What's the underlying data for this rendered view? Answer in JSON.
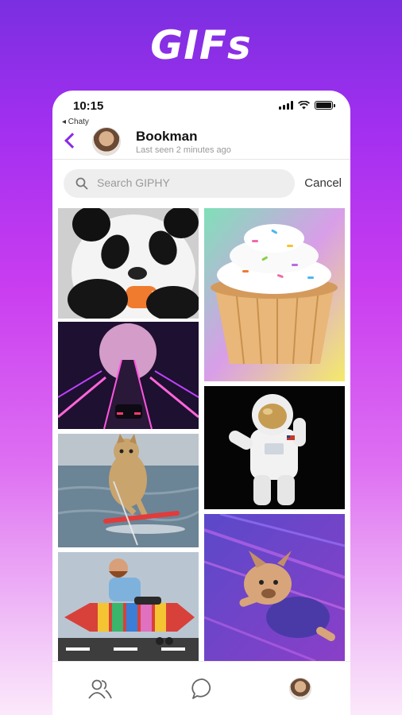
{
  "hero": {
    "title": "GIFs"
  },
  "status_bar": {
    "time": "10:15"
  },
  "back_app": {
    "label": "◂ Chaty"
  },
  "chat": {
    "contact_name": "Bookman",
    "contact_status": "Last seen 2 minutes ago"
  },
  "search": {
    "placeholder": "Search GIPHY",
    "cancel_label": "Cancel"
  },
  "gifs": [
    {
      "subject": "panda eating popsicle"
    },
    {
      "subject": "cupcake"
    },
    {
      "subject": "retro synthwave road with moon"
    },
    {
      "subject": "astronaut"
    },
    {
      "subject": "cat water skiing"
    },
    {
      "subject": "french bulldog flying"
    },
    {
      "subject": "man riding rocket"
    }
  ],
  "bottom_nav": {
    "items": [
      "contacts-icon",
      "chat-bubble-icon",
      "profile-avatar"
    ]
  },
  "colors": {
    "accent": "#8a2be2"
  }
}
